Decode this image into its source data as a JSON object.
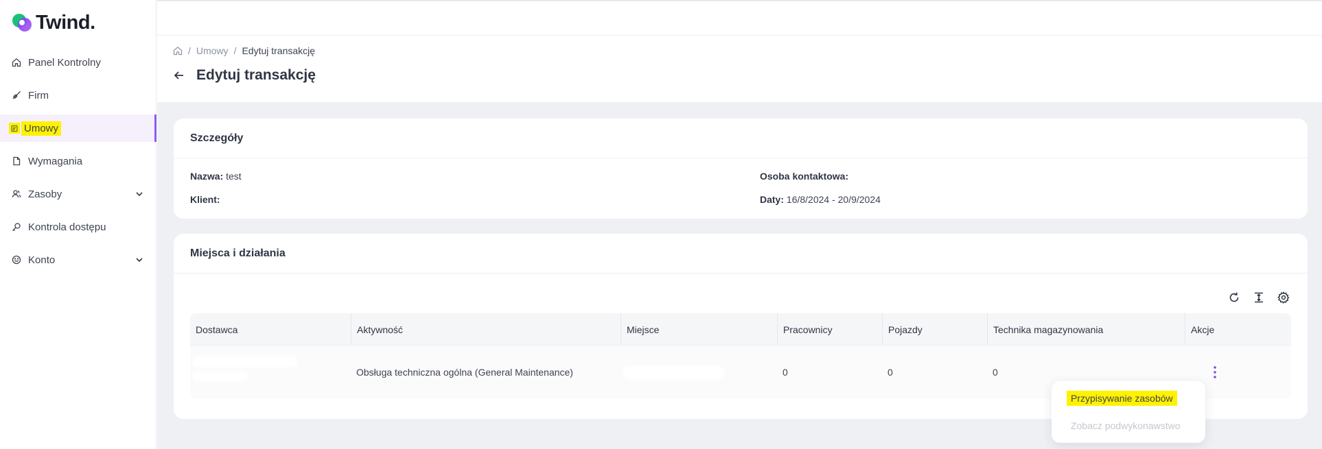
{
  "app": {
    "name": "Twind."
  },
  "sidebar": {
    "items": [
      {
        "label": "Panel Kontrolny",
        "icon": "home-icon"
      },
      {
        "label": "Firm",
        "icon": "rocket-icon"
      },
      {
        "label": "Umowy",
        "icon": "contract-icon",
        "active": true
      },
      {
        "label": "Wymagania",
        "icon": "document-icon"
      },
      {
        "label": "Zasoby",
        "icon": "users-icon",
        "expandable": true
      },
      {
        "label": "Kontrola dostępu",
        "icon": "key-icon"
      },
      {
        "label": "Konto",
        "icon": "smile-icon",
        "expandable": true
      }
    ]
  },
  "breadcrumb": {
    "parent": "Umowy",
    "current": "Edytuj transakcję",
    "separator": "/"
  },
  "page": {
    "title": "Edytuj transakcję"
  },
  "details": {
    "title": "Szczegóły",
    "name_label": "Nazwa:",
    "name_value": "test",
    "client_label": "Klient:",
    "contact_label": "Osoba kontaktowa:",
    "dates_label": "Daty:",
    "dates_value": "16/8/2024 - 20/9/2024"
  },
  "places": {
    "title": "Miejsca i działania",
    "columns": [
      "Dostawca",
      "Aktywność",
      "Miejsce",
      "Pracownicy",
      "Pojazdy",
      "Technika magazynowania",
      "Akcje"
    ],
    "row": {
      "activity": "Obsługa techniczna ogólna (General Maintenance)",
      "workers": "0",
      "vehicles": "0",
      "storage": "0"
    }
  },
  "actions_menu": {
    "items": [
      "Przypisywanie zasobów",
      "Zobacz podwykonawstwo"
    ]
  },
  "colors": {
    "accent": "#8a5cf0",
    "highlight": "#fff200",
    "brand_green": "#22c55e"
  }
}
